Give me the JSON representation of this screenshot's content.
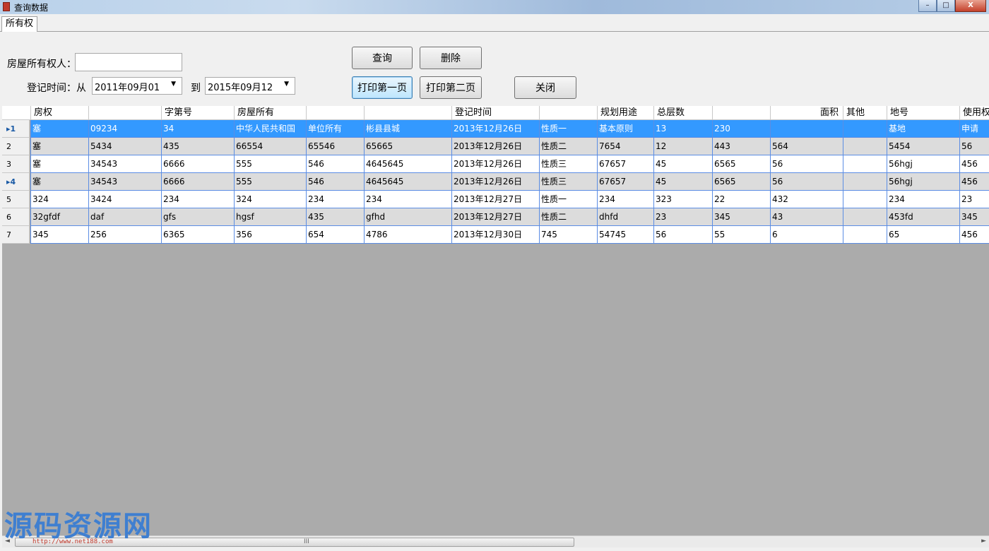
{
  "window": {
    "title": "查询数据",
    "minimize": "–",
    "maximize": "□",
    "close": "X"
  },
  "tab": {
    "label": "所有权"
  },
  "form": {
    "owner_label": "房屋所有权人：",
    "owner_value": "",
    "date_label": "登记时间：从",
    "date_from": "2011年09月01",
    "to_label": "到",
    "date_to": "2015年09月12",
    "dropdown": "▼"
  },
  "buttons": {
    "query": "查询",
    "delete": "删除",
    "print_first": "打印第一页",
    "print_second": "打印第二页",
    "close": "关闭"
  },
  "grid": {
    "headers": [
      "房权",
      "",
      "字第号",
      "房屋所有",
      "",
      "",
      "登记时间",
      "",
      "规划用途",
      "总层数",
      "",
      "面积",
      "其他",
      "地号",
      "使用权"
    ],
    "rows": [
      {
        "num": "1",
        "cur": true,
        "cells": [
          "塞",
          "09234",
          "34",
          "中华人民共和国",
          "单位所有",
          "彬县县城",
          "2013年12月26日",
          "性质一",
          "基本原则",
          "13",
          "230",
          "",
          "",
          "基地",
          "申请"
        ]
      },
      {
        "num": "2",
        "cur": false,
        "cells": [
          "塞",
          "5434",
          "435",
          "66554",
          "65546",
          "65665",
          "2013年12月26日",
          "性质二",
          "7654",
          "12",
          "443",
          "564",
          "",
          "5454",
          "56"
        ]
      },
      {
        "num": "3",
        "cur": false,
        "cells": [
          "塞",
          "34543",
          "6666",
          "555",
          "546",
          "4645645",
          "2013年12月26日",
          "性质三",
          "67657",
          "45",
          "6565",
          "56",
          "",
          "56hgj",
          "456"
        ]
      },
      {
        "num": "4",
        "cur": true,
        "cells": [
          "塞",
          "34543",
          "6666",
          "555",
          "546",
          "4645645",
          "2013年12月26日",
          "性质三",
          "67657",
          "45",
          "6565",
          "56",
          "",
          "56hgj",
          "456"
        ]
      },
      {
        "num": "5",
        "cur": false,
        "cells": [
          "324",
          "3424",
          "234",
          "324",
          "234",
          "234",
          "2013年12月27日",
          "性质一",
          "234",
          "323",
          "22",
          "432",
          "",
          "234",
          "23"
        ]
      },
      {
        "num": "6",
        "cur": false,
        "cells": [
          "32gfdf",
          "daf",
          "gfs",
          "hgsf",
          "435",
          "gfhd",
          "2013年12月27日",
          "性质二",
          "dhfd",
          "23",
          "345",
          "43",
          "",
          "453fd",
          "345"
        ]
      },
      {
        "num": "7",
        "cur": false,
        "cells": [
          "345",
          "256",
          "6365",
          "356",
          "654",
          "4786",
          "2013年12月30日",
          "745",
          "54745",
          "56",
          "55",
          "6",
          "",
          "65",
          "456"
        ]
      }
    ]
  },
  "scrollbar": {
    "left": "◄",
    "right": "►",
    "grip": "III"
  },
  "watermark": {
    "text": "源码资源网",
    "url": "http://www.net188.com"
  }
}
